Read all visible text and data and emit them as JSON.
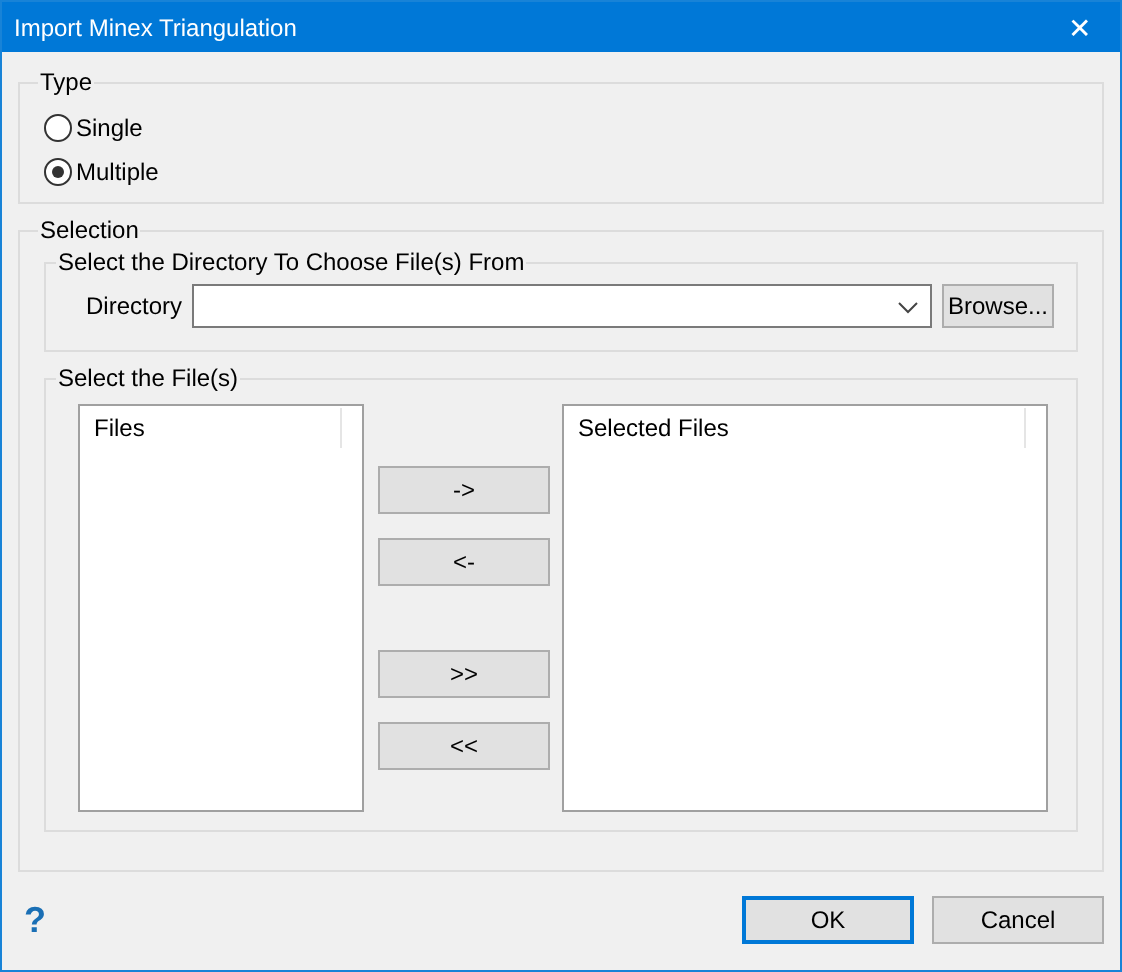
{
  "window": {
    "title": "Import Minex Triangulation",
    "close": "✕"
  },
  "type_group": {
    "legend": "Type",
    "options": [
      {
        "label": "Single",
        "selected": false
      },
      {
        "label": "Multiple",
        "selected": true
      }
    ]
  },
  "selection_group": {
    "legend": "Selection",
    "directory_group": {
      "legend": "Select the Directory To Choose File(s) From",
      "label": "Directory",
      "browse": "Browse..."
    },
    "files_group": {
      "legend": "Select the File(s)",
      "files_header": "Files",
      "selected_header": "Selected Files",
      "transfer_groups": [
        {
          "buttons": [
            "->",
            "<-"
          ]
        },
        {
          "buttons": [
            ">>",
            "<<"
          ]
        }
      ]
    }
  },
  "footer": {
    "help": "?",
    "buttons": [
      {
        "label": "OK",
        "default": true
      },
      {
        "label": "Cancel",
        "default": false
      }
    ]
  }
}
